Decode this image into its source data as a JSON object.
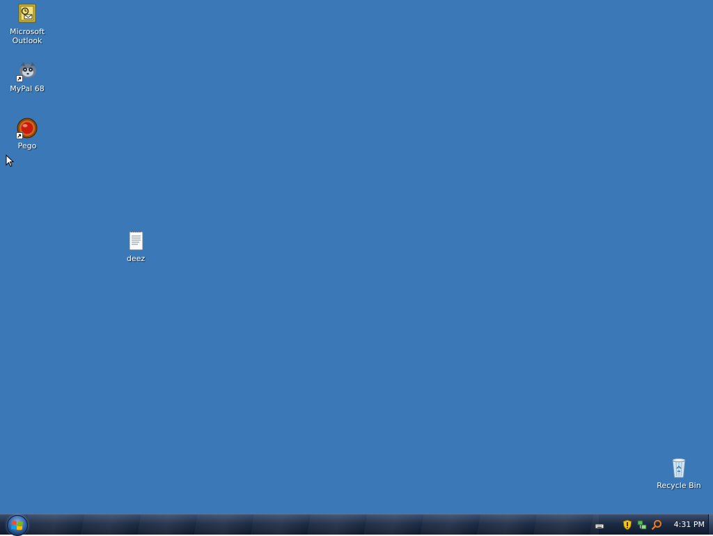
{
  "desktop": {
    "background_color": "#3b78b8",
    "icons": [
      {
        "label": "Microsoft Outlook",
        "icon": "outlook-icon"
      },
      {
        "label": "MyPal 68",
        "icon": "mypal-icon"
      },
      {
        "label": "Pego",
        "icon": "pego-icon"
      },
      {
        "label": "deez",
        "icon": "text-document-icon"
      },
      {
        "label": "Recycle Bin",
        "icon": "recycle-bin-icon"
      }
    ]
  },
  "taskbar": {
    "start_button": "start-orb-icon",
    "tray_icons": [
      "keyboard-icon",
      "security-shield-icon",
      "network-icon",
      "search-icon"
    ],
    "clock": "4:31 PM"
  }
}
